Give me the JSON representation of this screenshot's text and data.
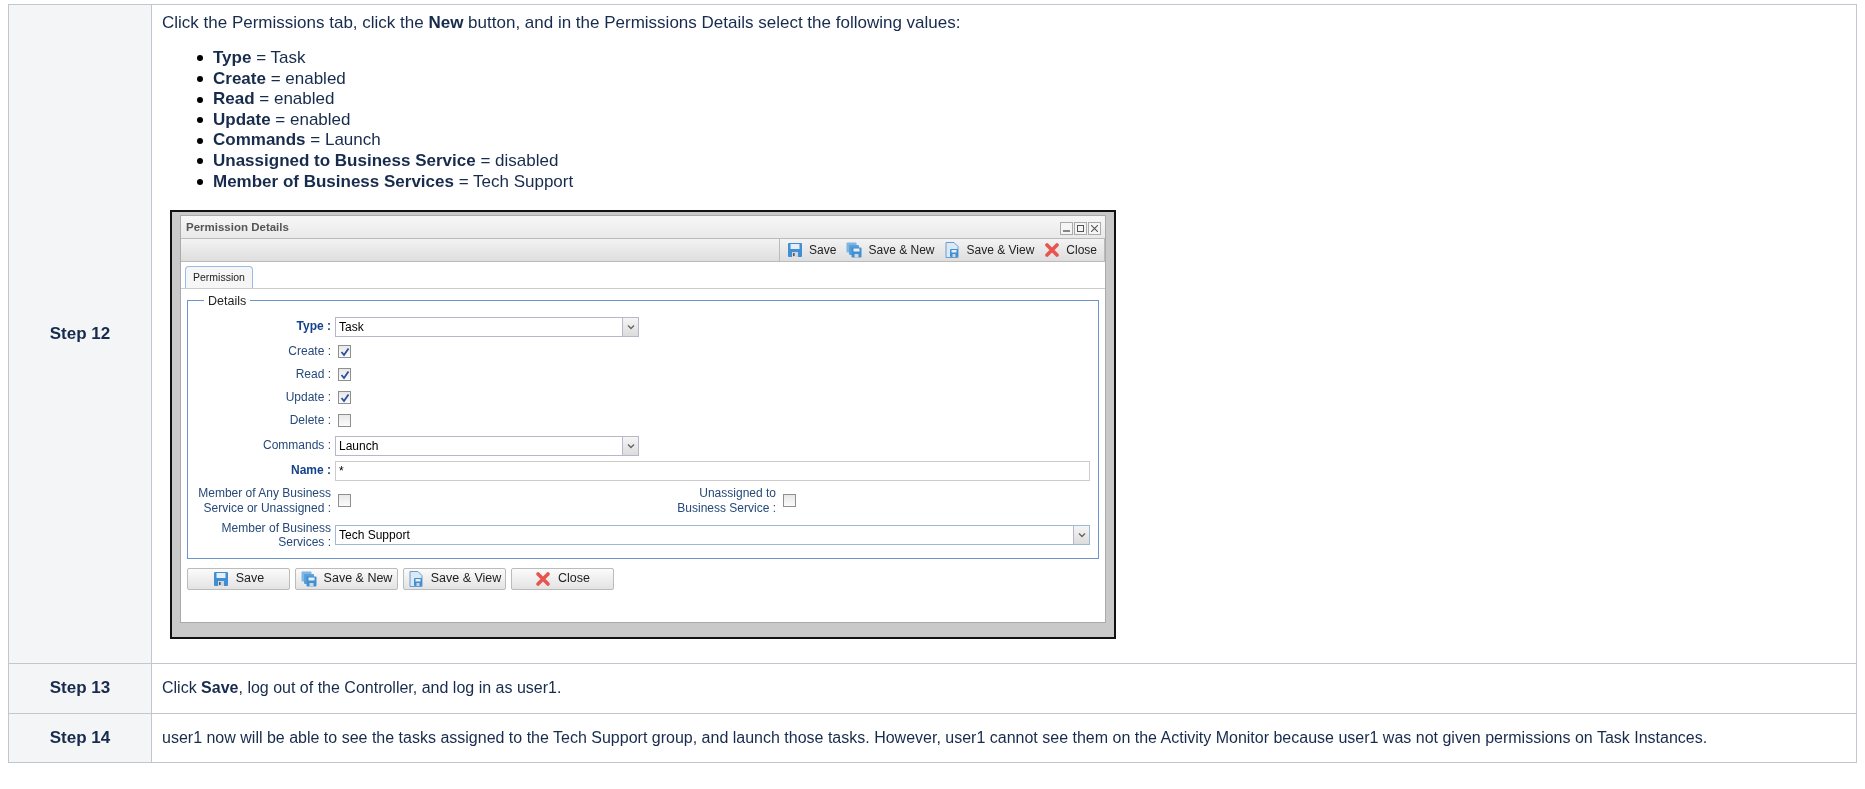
{
  "steps": [
    {
      "kind": "form",
      "step": "Step 12",
      "intro": "Click the Permissions tab, click the **New** button, and in the Permissions Details select the following values:",
      "bullets": [
        "**Type** = Task",
        "**Create** = enabled",
        "**Read** = enabled",
        "**Update** = enabled",
        "**Commands** = Launch",
        "**Unassigned to Business Service** = disabled",
        "**Member of Business Services** = Tech Support"
      ],
      "window": {
        "title": "Permission Details",
        "toolbar": [
          {
            "kind": "save",
            "label": "Save"
          },
          {
            "kind": "save_new",
            "label": "Save & New"
          },
          {
            "kind": "save_view",
            "label": "Save & View"
          },
          {
            "kind": "close",
            "label": "Close"
          }
        ],
        "tabs": [
          {
            "label": "Permission",
            "selected": true
          }
        ],
        "legend": "Details",
        "fields": [
          {
            "kind": "select",
            "label": "Type :",
            "required": true,
            "value": "Task"
          },
          {
            "kind": "checkbox",
            "label": "Create :",
            "required": false,
            "checked": true
          },
          {
            "kind": "checkbox",
            "label": "Read :",
            "required": false,
            "checked": true
          },
          {
            "kind": "checkbox",
            "label": "Update :",
            "required": false,
            "checked": true
          },
          {
            "kind": "checkbox",
            "label": "Delete :",
            "required": false,
            "checked": false
          },
          {
            "kind": "select",
            "label": "Commands :",
            "required": false,
            "value": "Launch"
          },
          {
            "kind": "text",
            "label": "Name :",
            "required": true,
            "value": "*"
          },
          {
            "kind": "checkbox_pair",
            "items": [
              {
                "label": "Member of Any Business Service or Unassigned :",
                "checked": false
              },
              {
                "label": "Unassigned to Business Service :",
                "checked": false
              }
            ]
          },
          {
            "kind": "select_wide",
            "label": "Member of Business Services :",
            "required": false,
            "value": "Tech Support"
          }
        ],
        "buttons": [
          {
            "kind": "save",
            "label": "Save"
          },
          {
            "kind": "save_new",
            "label": "Save & New"
          },
          {
            "kind": "save_view",
            "label": "Save & View"
          },
          {
            "kind": "close",
            "label": "Close"
          }
        ]
      }
    },
    {
      "kind": "text",
      "step": "Step 13",
      "text": "Click **Save**, log out of the Controller, and log in as user1."
    },
    {
      "kind": "text",
      "step": "Step 14",
      "text": "user1 now will be able to see the tasks assigned to the Tech Support group, and launch those tasks. However, user1 cannot see them on the Activity Monitor because user1 was not given permissions on Task Instances."
    }
  ]
}
